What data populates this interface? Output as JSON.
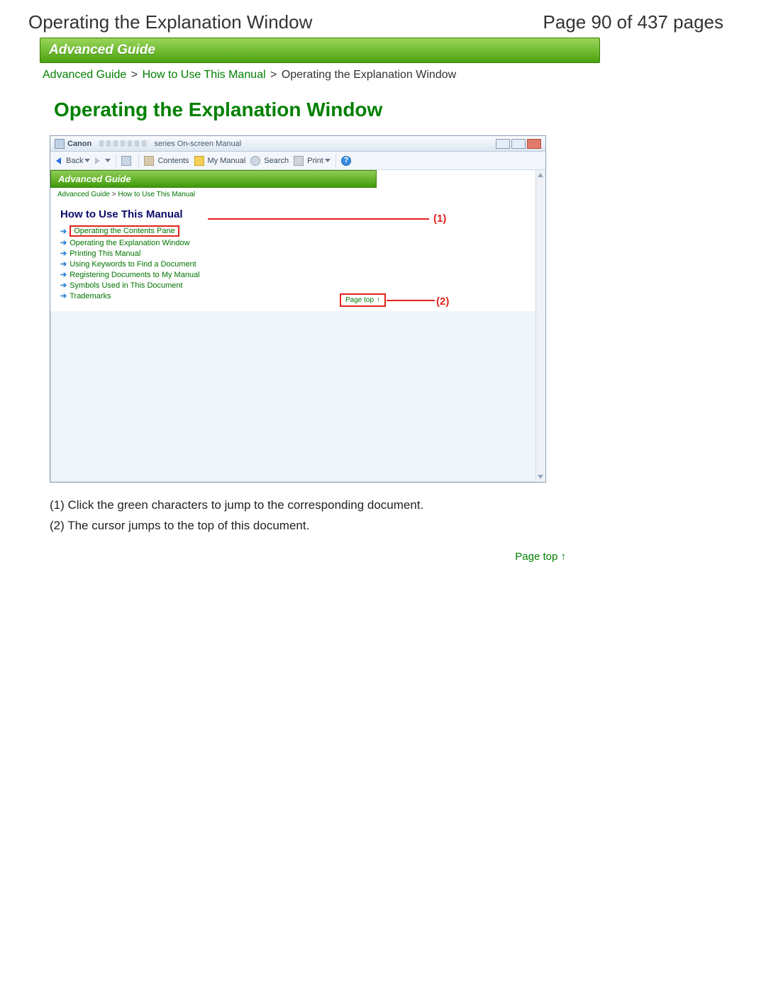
{
  "header": {
    "title": "Operating the Explanation Window",
    "page_indicator": "Page 90 of 437 pages"
  },
  "banner": "Advanced Guide",
  "breadcrumb": {
    "l1": "Advanced Guide",
    "l2": "How to Use This Manual",
    "current": "Operating the Explanation Window",
    "sep": ">"
  },
  "main_title": "Operating the Explanation Window",
  "screenshot": {
    "titlebar": {
      "brand": "Canon",
      "suffix": "series On-screen Manual"
    },
    "toolbar": {
      "back": "Back",
      "contents": "Contents",
      "mymanual": "My Manual",
      "search": "Search",
      "print": "Print"
    },
    "inner_banner": "Advanced Guide",
    "inner_breadcrumb": {
      "l1": "Advanced Guide",
      "l2": "How to Use This Manual",
      "sep": ">"
    },
    "how_title": "How to Use This Manual",
    "links": [
      "Operating the Contents Pane",
      "Operating the Explanation Window",
      "Printing This Manual",
      "Using Keywords to Find a Document",
      "Registering Documents to My Manual",
      "Symbols Used in This Document",
      "Trademarks"
    ],
    "callout1": "(1)",
    "callout2": "(2)",
    "pagetop_label": "Page top",
    "pagetop_arrow": "↑"
  },
  "notes": {
    "n1": "(1) Click the green characters to jump to the corresponding document.",
    "n2": "(2) The cursor jumps to the top of this document."
  },
  "footer": {
    "label": "Page top",
    "arrow": "↑"
  }
}
